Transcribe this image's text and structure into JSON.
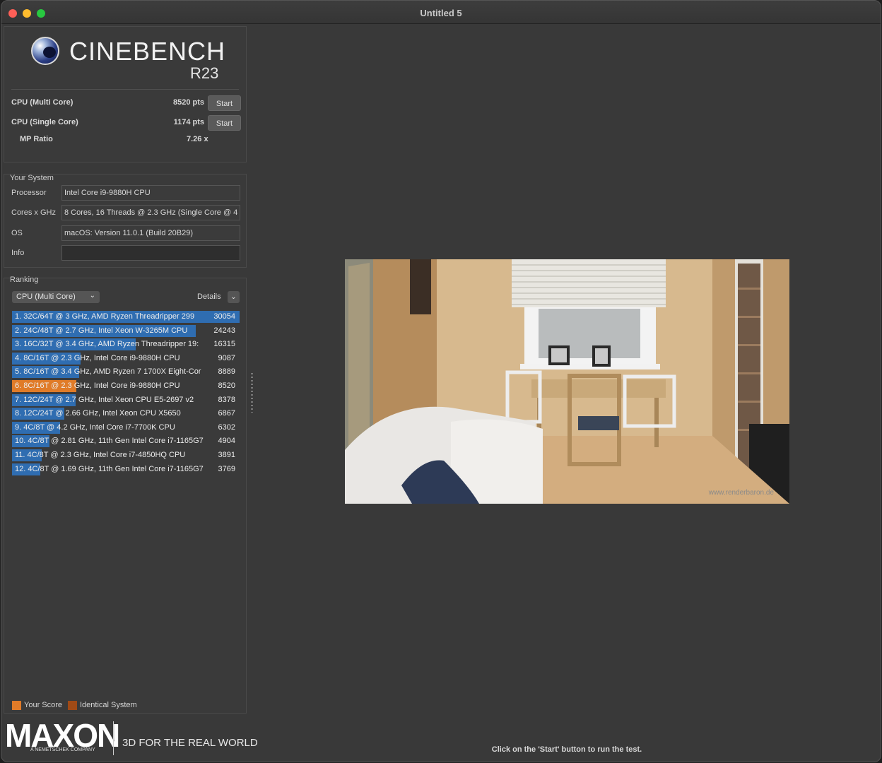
{
  "window": {
    "title": "Untitled 5"
  },
  "header": {
    "brand": "CINEBENCH",
    "version": "R23",
    "multi": {
      "label": "CPU (Multi Core)",
      "value": "8520 pts",
      "button": "Start"
    },
    "single": {
      "label": "CPU (Single Core)",
      "value": "1174 pts",
      "button": "Start"
    },
    "mp": {
      "label": "MP Ratio",
      "value": "7.26 x"
    }
  },
  "system": {
    "title": "Your System",
    "rows": [
      {
        "label": "Processor",
        "value": "Intel Core i9-9880H CPU"
      },
      {
        "label": "Cores x GHz",
        "value": "8 Cores, 16 Threads @ 2.3 GHz (Single Core @ 4"
      },
      {
        "label": "OS",
        "value": "macOS: Version 11.0.1 (Build 20B29)"
      },
      {
        "label": "Info",
        "value": ""
      }
    ]
  },
  "ranking": {
    "title": "Ranking",
    "dropdown": "CPU (Multi Core)",
    "details": "Details",
    "max_score": 30054,
    "rows": [
      {
        "name": "1. 32C/64T @ 3 GHz, AMD Ryzen Threadripper 299",
        "score": 30054,
        "yours": false
      },
      {
        "name": "2. 24C/48T @ 2.7 GHz, Intel Xeon W-3265M CPU",
        "score": 24243,
        "yours": false
      },
      {
        "name": "3. 16C/32T @ 3.4 GHz, AMD Ryzen Threadripper 19:",
        "score": 16315,
        "yours": false
      },
      {
        "name": "4. 8C/16T @ 2.3 GHz, Intel Core i9-9880H CPU",
        "score": 9087,
        "yours": false
      },
      {
        "name": "5. 8C/16T @ 3.4 GHz, AMD Ryzen 7 1700X Eight-Cor",
        "score": 8889,
        "yours": false
      },
      {
        "name": "6. 8C/16T @ 2.3 GHz, Intel Core i9-9880H CPU",
        "score": 8520,
        "yours": true
      },
      {
        "name": "7. 12C/24T @ 2.7 GHz, Intel Xeon CPU E5-2697 v2",
        "score": 8378,
        "yours": false
      },
      {
        "name": "8. 12C/24T @ 2.66 GHz, Intel Xeon CPU X5650",
        "score": 6867,
        "yours": false
      },
      {
        "name": "9. 4C/8T @ 4.2 GHz, Intel Core i7-7700K CPU",
        "score": 6302,
        "yours": false
      },
      {
        "name": "10. 4C/8T @ 2.81 GHz, 11th Gen Intel Core i7-1165G7",
        "score": 4904,
        "yours": false
      },
      {
        "name": "11. 4C/8T @ 2.3 GHz, Intel Core i7-4850HQ CPU",
        "score": 3891,
        "yours": false
      },
      {
        "name": "12. 4C/8T @ 1.69 GHz, 11th Gen Intel Core i7-1165G7",
        "score": 3769,
        "yours": false
      }
    ],
    "legend": [
      {
        "label": "Your Score",
        "color": "#e07b28"
      },
      {
        "label": "Identical System",
        "color": "#a04a16"
      }
    ]
  },
  "footer": {
    "logo": "MAXON",
    "logo_sub": "A NEMETSCHEK COMPANY",
    "tagline": "3D FOR THE REAL WORLD"
  },
  "render": {
    "watermark": "www.renderbaron.de"
  },
  "status": "Click on the 'Start' button to run the test.",
  "colors": {
    "bar": "#2f6db1",
    "your_score": "#e07b28",
    "identical": "#a04a16"
  }
}
